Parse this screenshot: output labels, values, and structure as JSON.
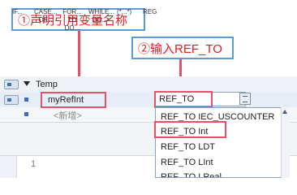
{
  "annotations": {
    "step1": "①声明引用变量名称",
    "step2": "②输入REF_TO"
  },
  "variables": {
    "section": "Temp",
    "var_name": "myRefInt",
    "type_value": "REF_TO",
    "new_placeholder": "<新增>"
  },
  "toolbar": {
    "if": "IF...",
    "case": "CASE... OF...",
    "for": "FOR... TO DO...",
    "while": "WHILE... DO...",
    "comment": "(*...*)",
    "region": "REG"
  },
  "editor": {
    "line_number": "1"
  },
  "dropdown": {
    "items": [
      "REF_TO IEC_USCOUNTER",
      "REF_TO Int",
      "REF_TO LDT",
      "REF_TO LInt",
      "REF_TO LReal"
    ],
    "selected": "REF_TO Int"
  }
}
